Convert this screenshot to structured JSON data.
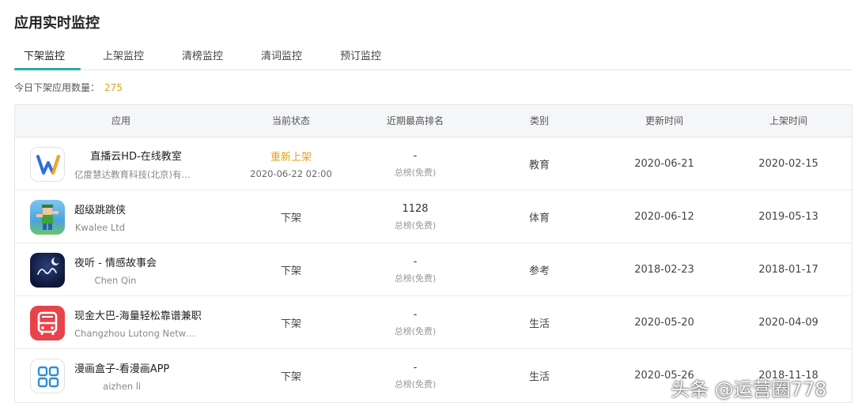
{
  "page": {
    "title": "应用实时监控"
  },
  "tabs": [
    {
      "label": "下架监控",
      "active": true
    },
    {
      "label": "上架监控",
      "active": false
    },
    {
      "label": "清榜监控",
      "active": false
    },
    {
      "label": "清词监控",
      "active": false
    },
    {
      "label": "预订监控",
      "active": false
    }
  ],
  "summary": {
    "label": "今日下架应用数量：",
    "value": "275"
  },
  "table": {
    "headers": {
      "app": "应用",
      "status": "当前状态",
      "rank": "近期最高排名",
      "category": "类别",
      "updated": "更新时间",
      "listed": "上架时间"
    },
    "rows": [
      {
        "name": "直播云HD-在线教室",
        "developer": "亿度慧达教育科技(北京)有限公司",
        "icon": "zhiboyun-w-icon",
        "status": "重新上架",
        "status_time": "2020-06-22 02:00",
        "rank": "-",
        "rank_sub": "总榜(免费)",
        "category": "教育",
        "updated": "2020-06-21",
        "listed": "2020-02-15"
      },
      {
        "name": "超级跳跳侠",
        "developer": "Kwalee Ltd",
        "icon": "jumping-hero-icon",
        "status": "下架",
        "status_time": "",
        "rank": "1128",
        "rank_sub": "总榜(免费)",
        "category": "体育",
        "updated": "2020-06-12",
        "listed": "2019-05-13"
      },
      {
        "name": "夜听 - 情感故事会",
        "developer": "Chen Qin",
        "icon": "night-listen-moon-icon",
        "status": "下架",
        "status_time": "",
        "rank": "-",
        "rank_sub": "总榜(免费)",
        "category": "参考",
        "updated": "2018-02-23",
        "listed": "2018-01-17"
      },
      {
        "name": "现金大巴-海量轻松靠谱兼职",
        "developer": "Changzhou Lutong Network Technology",
        "icon": "bus-icon",
        "status": "下架",
        "status_time": "",
        "rank": "-",
        "rank_sub": "总榜(免费)",
        "category": "生活",
        "updated": "2020-05-20",
        "listed": "2020-04-09"
      },
      {
        "name": "漫画盒子-看漫画APP",
        "developer": "aizhen li",
        "icon": "comic-box-grid-icon",
        "status": "下架",
        "status_time": "",
        "rank": "-",
        "rank_sub": "总榜(免费)",
        "category": "生活",
        "updated": "2020-05-26",
        "listed": "2018-11-18"
      }
    ]
  },
  "watermark": "头条 @运营圈778",
  "colors": {
    "accent": "#1fb19e",
    "relisted": "#e3a21a",
    "count": "#e3a21a"
  }
}
